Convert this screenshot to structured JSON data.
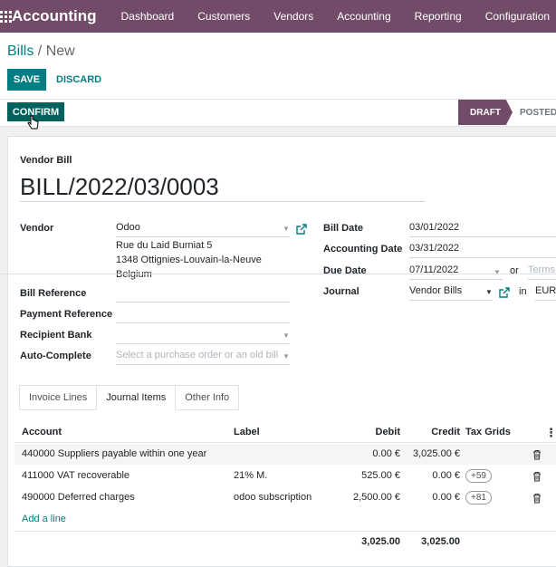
{
  "topbar": {
    "app_title": "Accounting",
    "menu": [
      "Dashboard",
      "Customers",
      "Vendors",
      "Accounting",
      "Reporting",
      "Configuration"
    ]
  },
  "breadcrumb": {
    "parent": "Bills",
    "separator": " / ",
    "current": "New"
  },
  "buttons": {
    "save": "SAVE",
    "discard": "DISCARD",
    "confirm": "CONFIRM"
  },
  "status": {
    "draft": "DRAFT",
    "posted": "POSTED"
  },
  "form": {
    "type_label": "Vendor Bill",
    "name": "BILL/2022/03/0003",
    "vendor_label": "Vendor",
    "vendor": "Odoo",
    "vendor_address": [
      "Rue du Laid Burniat 5",
      "1348 Ottignies-Louvain-la-Neuve",
      "Belgium"
    ],
    "bill_reference_label": "Bill Reference",
    "payment_reference_label": "Payment Reference",
    "recipient_bank_label": "Recipient Bank",
    "auto_complete_label": "Auto-Complete",
    "auto_complete_placeholder": "Select a purchase order or an old bill",
    "bill_date_label": "Bill Date",
    "bill_date": "03/01/2022",
    "accounting_date_label": "Accounting Date",
    "accounting_date": "03/31/2022",
    "due_date_label": "Due Date",
    "due_date": "07/11/2022",
    "or_text": "or",
    "terms_placeholder": "Terms",
    "journal_label": "Journal",
    "journal": "Vendor Bills",
    "in_text": "in",
    "currency": "EUR"
  },
  "tabs": [
    "Invoice Lines",
    "Journal Items",
    "Other Info"
  ],
  "table": {
    "headers": {
      "account": "Account",
      "label": "Label",
      "debit": "Debit",
      "credit": "Credit",
      "tax_grids": "Tax Grids"
    },
    "rows": [
      {
        "account": "440000 Suppliers payable within one year",
        "label": "",
        "debit": "0.00 €",
        "credit": "3,025.00 €",
        "tax": ""
      },
      {
        "account": "411000 VAT recoverable",
        "label": "21% M.",
        "debit": "525.00 €",
        "credit": "0.00 €",
        "tax": "+59"
      },
      {
        "account": "490000 Deferred charges",
        "label": "odoo subscription",
        "debit": "2,500.00 €",
        "credit": "0.00 €",
        "tax": "+81"
      }
    ],
    "add_line": "Add a line",
    "total_debit": "3,025.00",
    "total_credit": "3,025.00"
  },
  "colors": {
    "brand": "#714B67",
    "accent": "#017e84"
  }
}
